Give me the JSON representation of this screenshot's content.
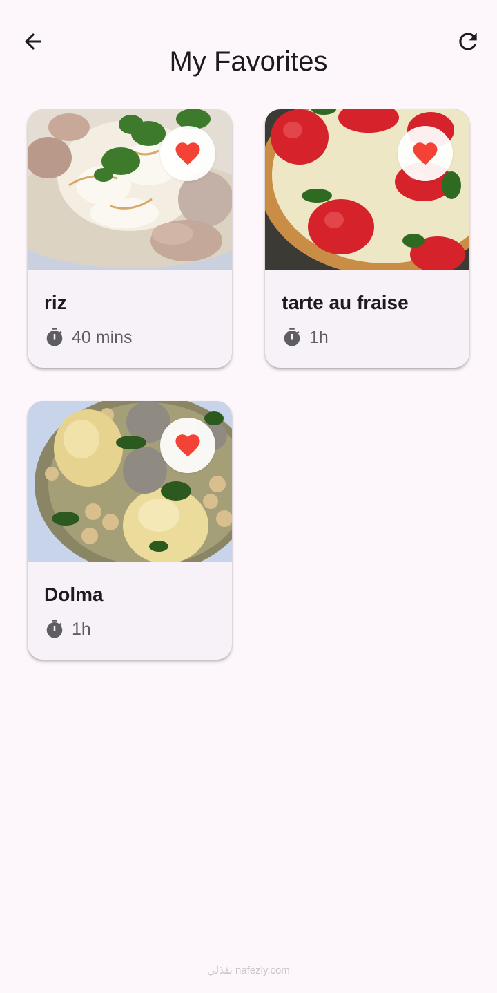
{
  "header": {
    "title": "My Favorites",
    "back_icon": "arrow-left-icon",
    "refresh_icon": "refresh-icon"
  },
  "recipes": [
    {
      "name": "riz",
      "time": "40 mins",
      "image": "rice-with-chicken-photo",
      "favorite": true
    },
    {
      "name": "tarte au fraise",
      "time": "1h",
      "image": "strawberry-tart-photo",
      "favorite": true
    },
    {
      "name": "Dolma",
      "time": "1h",
      "image": "dolma-stew-photo",
      "favorite": true
    }
  ],
  "colors": {
    "background": "#fdf6fb",
    "card": "#f7f1f8",
    "heart": "#f44336",
    "text": "#1d1b20",
    "muted": "#5f5d63"
  },
  "watermark": "نفذلي nafezly.com"
}
